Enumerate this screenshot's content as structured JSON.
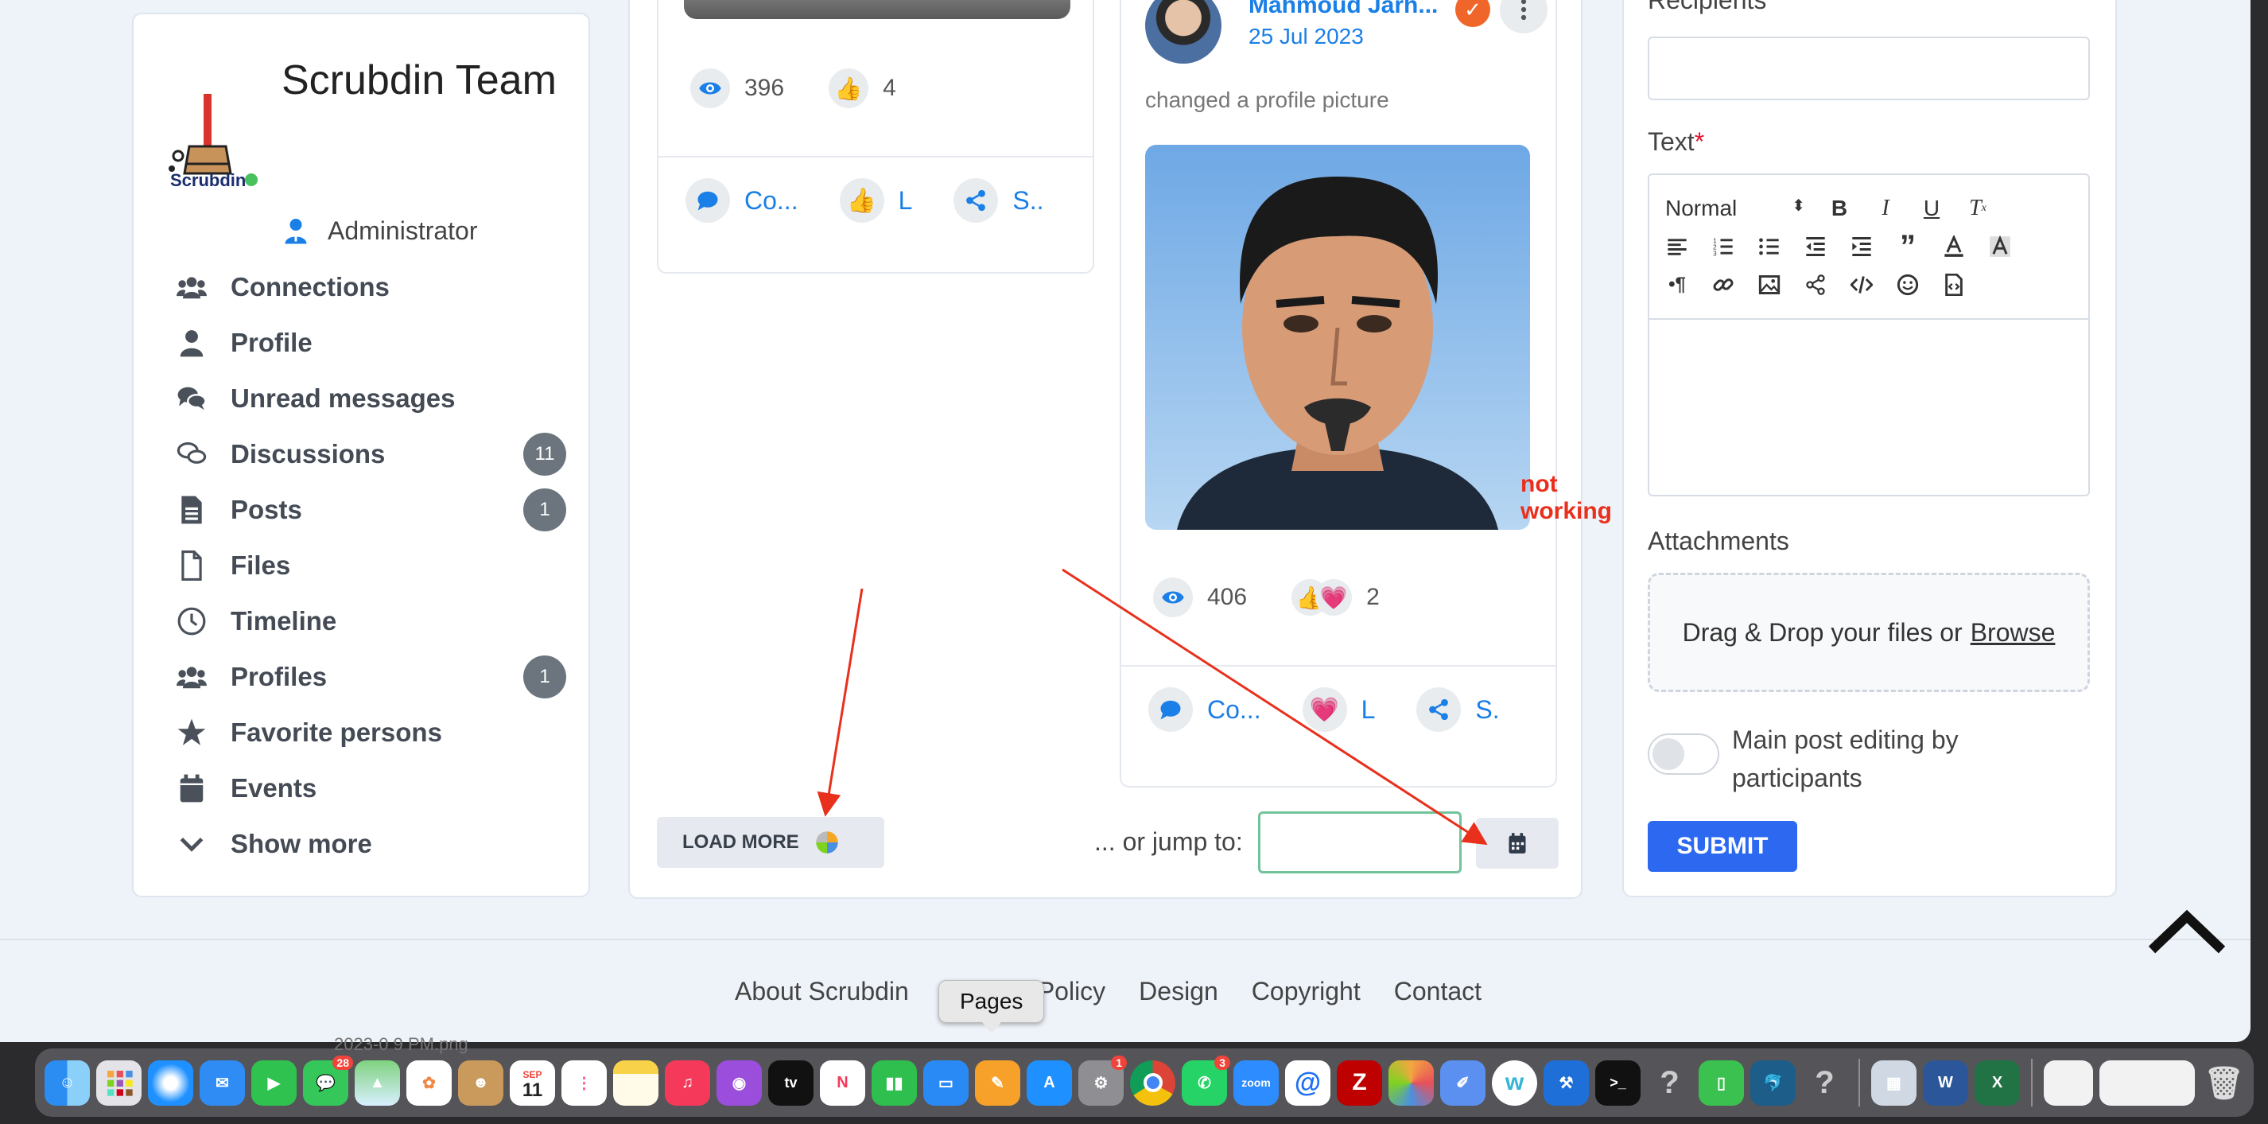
{
  "sidebar": {
    "team_name": "Scrubdin Team",
    "role": "Administrator",
    "logo_text": "Scrubdin",
    "items": [
      {
        "label": "Connections",
        "icon": "users-icon",
        "badge": ""
      },
      {
        "label": "Profile",
        "icon": "user-icon",
        "badge": ""
      },
      {
        "label": "Unread messages",
        "icon": "comments-icon",
        "badge": ""
      },
      {
        "label": "Discussions",
        "icon": "comments-outline-icon",
        "badge": "11"
      },
      {
        "label": "Posts",
        "icon": "document-icon",
        "badge": "1"
      },
      {
        "label": "Files",
        "icon": "file-icon",
        "badge": ""
      },
      {
        "label": "Timeline",
        "icon": "clock-icon",
        "badge": ""
      },
      {
        "label": "Profiles",
        "icon": "users-icon",
        "badge": "1"
      },
      {
        "label": "Favorite persons",
        "icon": "star-icon",
        "badge": ""
      },
      {
        "label": "Events",
        "icon": "calendar-icon",
        "badge": ""
      },
      {
        "label": "Show more",
        "icon": "chevron-down-icon",
        "badge": ""
      }
    ]
  },
  "feed": {
    "post1": {
      "views": "396",
      "likes": "4",
      "actions": {
        "comment": "Co...",
        "like": "L",
        "share": "S.."
      }
    },
    "post2": {
      "author": "Mahmoud Jarh...",
      "date": "25 Jul 2023",
      "text": "changed a profile picture",
      "views": "406",
      "reactions": "2",
      "actions": {
        "comment": "Co...",
        "like": "L",
        "share": "S."
      }
    },
    "load_more": "LOAD MORE",
    "jump_label": "... or jump to:",
    "annotation": "not working"
  },
  "form": {
    "recipients_label": "Recipients",
    "text_label": "Text",
    "required_mark": "*",
    "format_select": "Normal",
    "attachments_label": "Attachments",
    "dropzone_text": "Drag & Drop your files or",
    "dropzone_link": "Browse",
    "toggle_label": "Main post editing by participants",
    "submit": "SUBMIT"
  },
  "footer": {
    "links": [
      "About Scrubdin",
      "Policy",
      "Design",
      "Copyright",
      "Contact"
    ],
    "tooltip": "Pages"
  },
  "dock": {
    "calendar_month": "SEP",
    "calendar_day": "11",
    "messages_badge": "28",
    "settings_badge": "1",
    "whatsapp_badge": "3",
    "behind_text": "2023-0  9 PM.png"
  },
  "colors": {
    "accent": "#1a7fe6",
    "submit": "#2c69f0",
    "badge": "#6c757d",
    "annotation": "#e8301c",
    "verified": "#f0662a"
  }
}
